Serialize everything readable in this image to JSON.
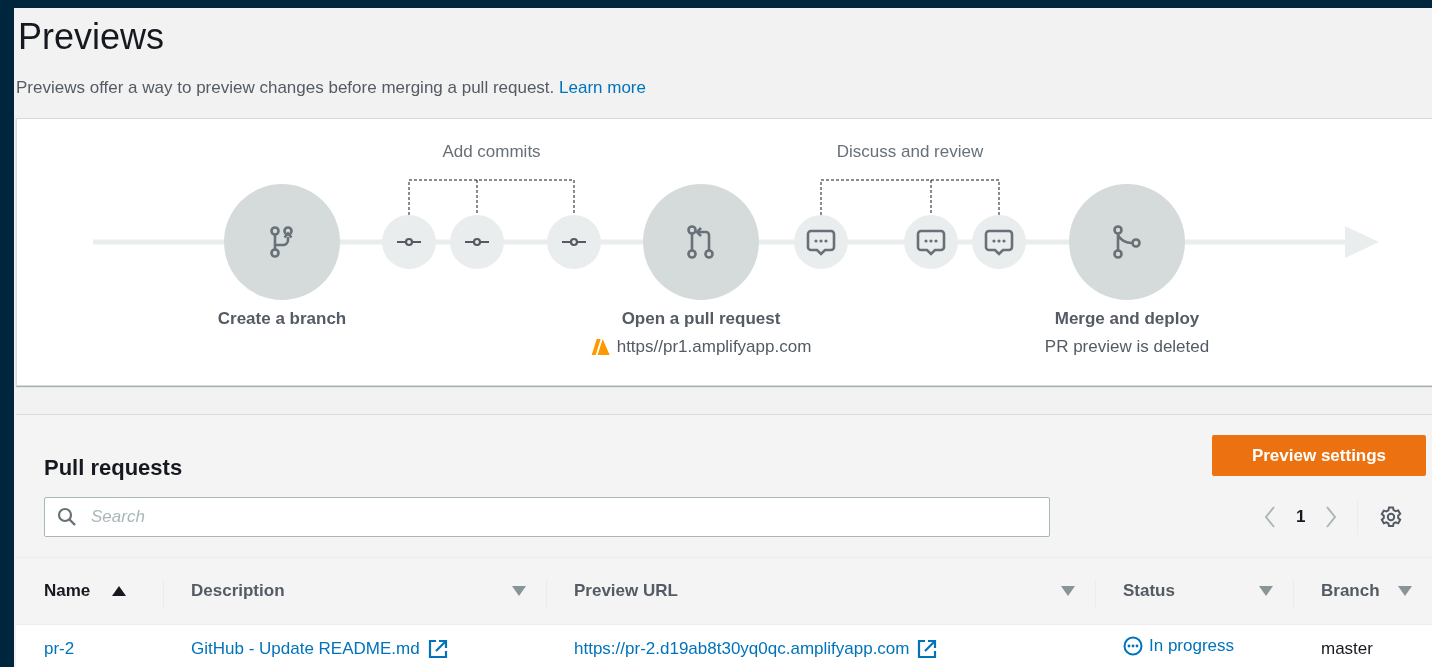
{
  "title": "Previews",
  "description": {
    "text": "Previews offer a way to preview changes before merging a pull request.",
    "link": "Learn more"
  },
  "diagram": {
    "groups": [
      {
        "label": "Add commits"
      },
      {
        "label": "Discuss and review"
      }
    ],
    "nodes": [
      {
        "kind": "branch",
        "label": "Create a branch"
      },
      {
        "kind": "commit"
      },
      {
        "kind": "commit"
      },
      {
        "kind": "commit"
      },
      {
        "kind": "pull-request",
        "label": "Open a pull request",
        "detail": "https//pr1.amplifyapp.com",
        "warning": true
      },
      {
        "kind": "comment"
      },
      {
        "kind": "comment"
      },
      {
        "kind": "comment"
      },
      {
        "kind": "merge",
        "label": "Merge and deploy",
        "detail": "PR preview is deleted"
      }
    ]
  },
  "pull_requests": {
    "title": "Pull requests",
    "button": "Preview settings",
    "search": {
      "placeholder": "Search"
    },
    "page": "1",
    "columns": [
      {
        "label": "Name",
        "sorted": true
      },
      {
        "label": "Description",
        "sorted": false
      },
      {
        "label": "Preview URL",
        "sorted": false
      },
      {
        "label": "Status",
        "sorted": false
      },
      {
        "label": "Branch",
        "sorted": false
      }
    ],
    "rows": [
      {
        "name": "pr-2",
        "description": "GitHub - Update README.md",
        "preview_url": "https://pr-2.d19ab8t30yq0qc.amplifyapp.com",
        "status": {
          "kind": "in-progress",
          "text": "In progress"
        },
        "branch": "master"
      }
    ]
  }
}
